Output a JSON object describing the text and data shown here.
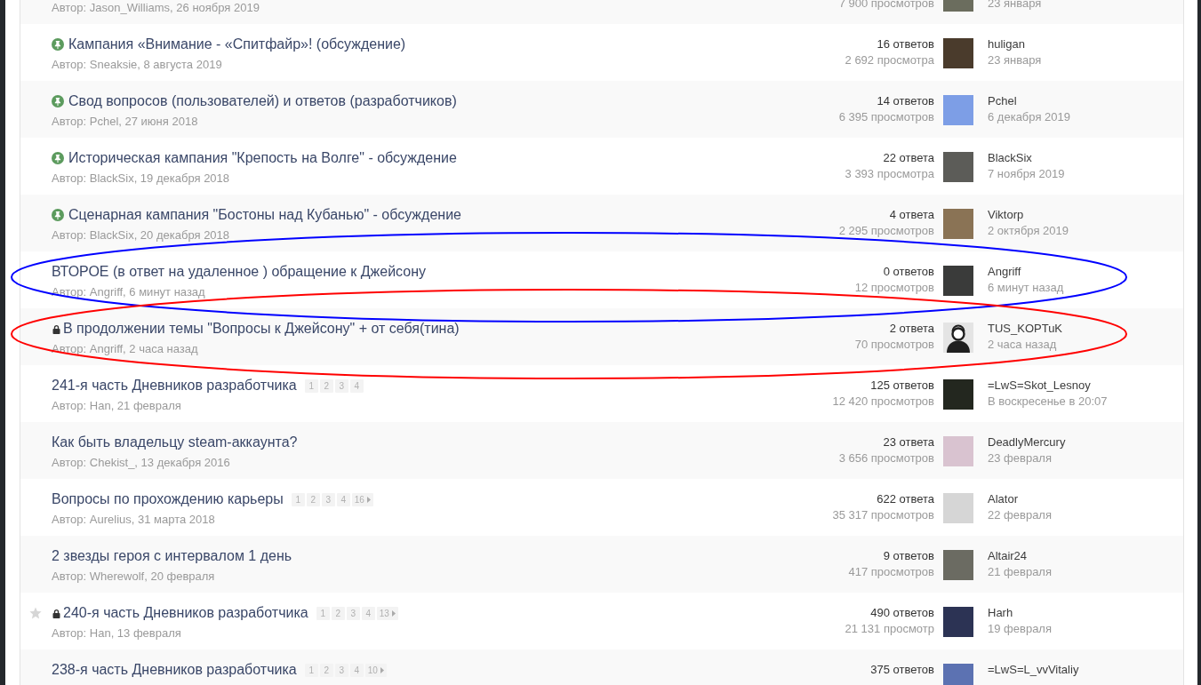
{
  "topics": [
    {
      "author_line": "Автор: Jason_Williams, 26 ноября 2019",
      "views": "7 900 просмотров",
      "avatar": {
        "kind": "photo",
        "color": "#6b6d5e"
      },
      "last_date": "23 января"
    },
    {
      "title": "Кампания «Внимание - «Спитфайр»! (обсуждение)",
      "pinned": true,
      "locked": false,
      "featured": false,
      "author_line": "Автор: Sneaksie, 8 августа 2019",
      "replies": "16 ответов",
      "views": "2 692 просмотра",
      "avatar": {
        "kind": "photo",
        "color": "#4a3b2c"
      },
      "last_user": "huligan",
      "last_date": "23 января"
    },
    {
      "title": "Свод вопросов (пользователей) и ответов (разработчиков)",
      "pinned": true,
      "locked": false,
      "featured": false,
      "author_line": "Автор: Pchel, 27 июня 2018",
      "replies": "14 ответов",
      "views": "6 395 просмотров",
      "avatar": {
        "kind": "photo",
        "color": "#7d9ee6"
      },
      "last_user": "Pchel",
      "last_date": "6 декабря 2019"
    },
    {
      "title": "Историческая кампания \"Крепость на Волге\" - обсуждение",
      "pinned": true,
      "locked": false,
      "featured": false,
      "author_line": "Автор: BlackSix, 19 декабря 2018",
      "replies": "22 ответа",
      "views": "3 393 просмотра",
      "avatar": {
        "kind": "photo",
        "color": "#5c5c58"
      },
      "last_user": "BlackSix",
      "last_date": "7 ноября 2019"
    },
    {
      "title": "Сценарная кампания \"Бостоны над Кубанью\" - обсуждение",
      "pinned": true,
      "locked": false,
      "featured": false,
      "author_line": "Автор: BlackSix, 20 декабря 2018",
      "replies": "4 ответа",
      "views": "2 295 просмотров",
      "avatar": {
        "kind": "photo",
        "color": "#8a7355"
      },
      "last_user": "Viktorp",
      "last_date": "2 октября 2019"
    },
    {
      "title": "ВТОРОЕ (в ответ на удаленное ) обращение к Джейсону",
      "pinned": false,
      "locked": false,
      "featured": false,
      "author_line": "Автор: Angriff, 6 минут назад",
      "replies": "0 ответов",
      "views": "12 просмотров",
      "avatar": {
        "kind": "photo",
        "color": "#3a3b3a"
      },
      "last_user": "Angriff",
      "last_date": "6 минут назад",
      "annotation": {
        "color": "#0000ff"
      }
    },
    {
      "title": "В продолжении темы \"Вопросы к Джейсону\" + от себя(тина)",
      "pinned": false,
      "locked": true,
      "featured": false,
      "author_line": "Автор: Angriff, 2 часа назад",
      "replies": "2 ответа",
      "views": "70 просмотров",
      "avatar": {
        "kind": "silhouette",
        "color": "#e4e4e4"
      },
      "last_user": "TUS_KOPTuK",
      "last_date": "2 часа назад",
      "annotation": {
        "color": "#ff0000"
      }
    },
    {
      "title": "241-я часть Дневников разработчика",
      "pinned": false,
      "locked": false,
      "featured": false,
      "pages": [
        {
          "label": "1",
          "kind": "page"
        },
        {
          "label": "2",
          "kind": "page"
        },
        {
          "label": "3",
          "kind": "page"
        },
        {
          "label": "4",
          "kind": "page"
        }
      ],
      "author_line": "Автор: Han, 21 февраля",
      "replies": "125 ответов",
      "views": "12 420 просмотров",
      "avatar": {
        "kind": "photo",
        "color": "#23271f"
      },
      "last_user": "=LwS=Skot_Lesnoy",
      "last_date": "В воскресенье в 20:07"
    },
    {
      "title": "Как быть владельцу steam-аккаунта?",
      "pinned": false,
      "locked": false,
      "featured": false,
      "author_line": "Автор: Chekist_, 13 декабря 2016",
      "replies": "23 ответа",
      "views": "3 656 просмотров",
      "avatar": {
        "kind": "photo",
        "color": "#d9c3d0"
      },
      "last_user": "DeadlyMercury",
      "last_date": "23 февраля"
    },
    {
      "title": "Вопросы по прохождению карьеры",
      "pinned": false,
      "locked": false,
      "featured": false,
      "pages": [
        {
          "label": "1",
          "kind": "page"
        },
        {
          "label": "2",
          "kind": "page"
        },
        {
          "label": "3",
          "kind": "page"
        },
        {
          "label": "4",
          "kind": "page"
        },
        {
          "label": "16",
          "kind": "last"
        }
      ],
      "author_line": "Автор: Aurelius, 31 марта 2018",
      "replies": "622 ответа",
      "views": "35 317 просмотров",
      "avatar": {
        "kind": "photo",
        "color": "#d6d6d6"
      },
      "last_user": "Alator",
      "last_date": "22 февраля"
    },
    {
      "title": "2 звезды героя с интервалом 1 день",
      "pinned": false,
      "locked": false,
      "featured": false,
      "author_line": "Автор: Wherewolf, 20 февраля",
      "replies": "9 ответов",
      "views": "417 просмотров",
      "avatar": {
        "kind": "photo",
        "color": "#6b6b62"
      },
      "last_user": "Altair24",
      "last_date": "21 февраля"
    },
    {
      "title": "240-я часть Дневников разработчика",
      "pinned": false,
      "locked": true,
      "featured": true,
      "pages": [
        {
          "label": "1",
          "kind": "page"
        },
        {
          "label": "2",
          "kind": "page"
        },
        {
          "label": "3",
          "kind": "page"
        },
        {
          "label": "4",
          "kind": "page"
        },
        {
          "label": "13",
          "kind": "last"
        }
      ],
      "author_line": "Автор: Han, 13 февраля",
      "replies": "490 ответов",
      "views": "21 131 просмотр",
      "avatar": {
        "kind": "photo",
        "color": "#2c3354"
      },
      "last_user": "Harh",
      "last_date": "19 февраля"
    },
    {
      "title": "238-я часть Дневников разработчика",
      "pinned": false,
      "locked": false,
      "featured": false,
      "pages": [
        {
          "label": "1",
          "kind": "page"
        },
        {
          "label": "2",
          "kind": "page"
        },
        {
          "label": "3",
          "kind": "page"
        },
        {
          "label": "4",
          "kind": "page"
        },
        {
          "label": "10",
          "kind": "last"
        }
      ],
      "replies": "375 ответов",
      "avatar": {
        "kind": "photo",
        "color": "#5c72b2"
      },
      "last_user": "=LwS=L_vvVitaliy"
    }
  ]
}
